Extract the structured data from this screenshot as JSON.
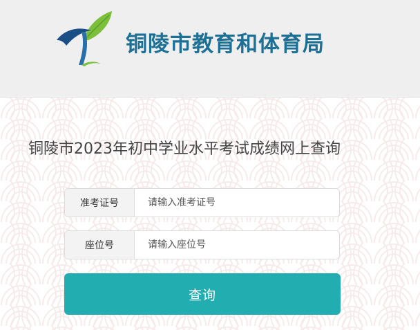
{
  "header": {
    "org_name": "铜陵市教育和体育局",
    "logo_icon": "leaf-t-logo-icon",
    "background_color": "#efefef",
    "org_name_color": "#1c6f95"
  },
  "main": {
    "title": "铜陵市2023年初中学业水平考试成绩网上查询",
    "fields": [
      {
        "label": "准考证号",
        "placeholder": "请输入准考证号",
        "value": ""
      },
      {
        "label": "座位号",
        "placeholder": "请输入座位号",
        "value": ""
      }
    ],
    "submit_label": "查询",
    "accent_color": "#22aeb0"
  }
}
